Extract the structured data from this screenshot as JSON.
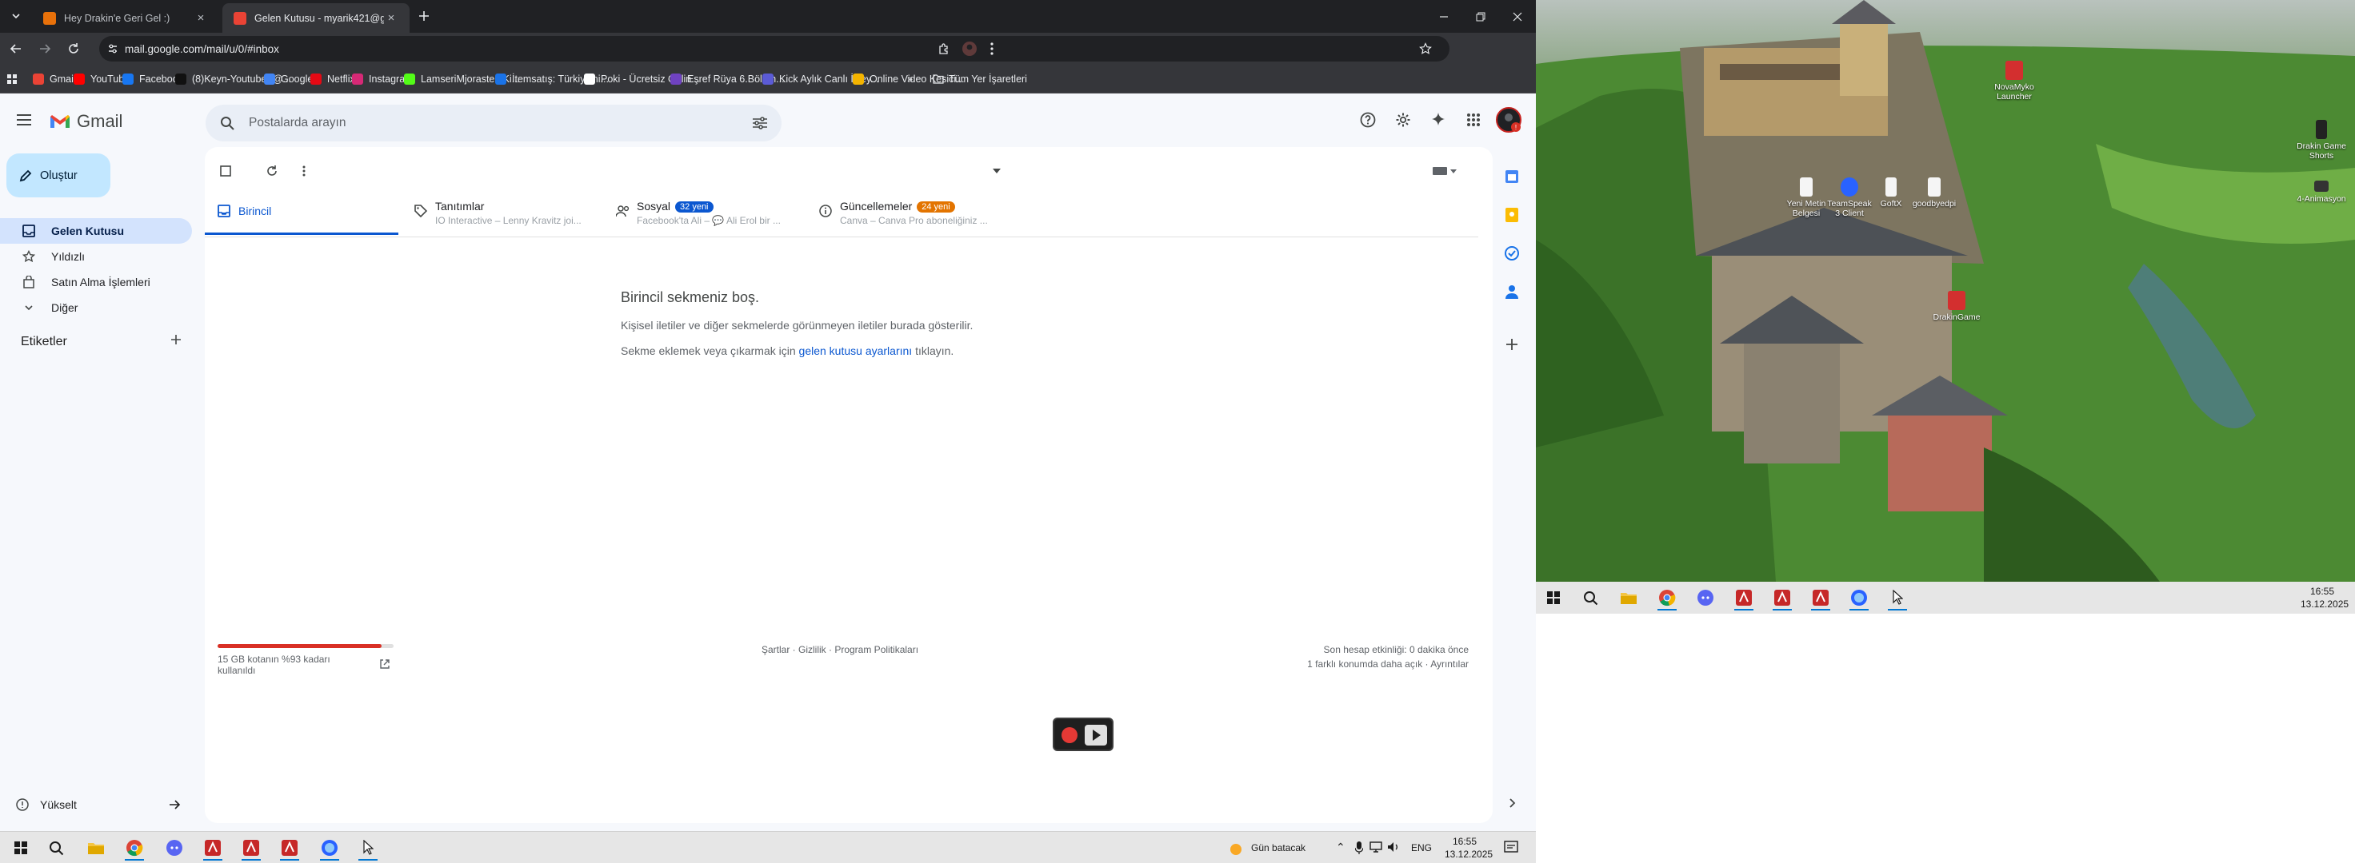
{
  "browser": {
    "tabs": [
      {
        "title": "Hey Drakin'e Geri Gel :)",
        "favicon_color": "#e8710a"
      },
      {
        "title": "Gelen Kutusu - myarik421@g...",
        "favicon_color": "#ea4335"
      }
    ],
    "url": "mail.google.com/mail/u/0/#inbox",
    "bookmarks": [
      {
        "label": "Gmail",
        "color": "#ea4335"
      },
      {
        "label": "YouTube",
        "color": "#ff0000"
      },
      {
        "label": "Facebook",
        "color": "#1877f2"
      },
      {
        "label": "(8)Keyn-Youtube (@...",
        "color": "#111111"
      },
      {
        "label": "Google",
        "color": "#4285f4"
      },
      {
        "label": "Netflix",
        "color": "#e50914"
      },
      {
        "label": "Instagram",
        "color": "#d62976"
      },
      {
        "label": "LamseriMjoraste | Ki...",
        "color": "#53fc18"
      },
      {
        "label": "İtemsatış: Türkiye'ni...",
        "color": "#1a73e8"
      },
      {
        "label": "Poki - Ücretsiz Onlin...",
        "color": "#ffffff"
      },
      {
        "label": "Eşref Rüya 6.Bölüm...",
        "color": "#6f42c1"
      },
      {
        "label": "Kick Aylık Canlı İzley...",
        "color": "#5b5bd6"
      },
      {
        "label": "Online Video Kesici...",
        "color": "#f4b400"
      }
    ],
    "all_bookmarks_label": "Tüm Yer İşaretleri"
  },
  "gmail": {
    "logo_text": "Gmail",
    "search_placeholder": "Postalarda arayın",
    "compose_label": "Oluştur",
    "nav": [
      {
        "label": "Gelen Kutusu",
        "icon": "inbox-icon",
        "active": true
      },
      {
        "label": "Yıldızlı",
        "icon": "star-icon",
        "active": false
      },
      {
        "label": "Satın Alma İşlemleri",
        "icon": "bag-icon",
        "active": false
      },
      {
        "label": "Diğer",
        "icon": "chevron-down-icon",
        "active": false
      }
    ],
    "labels_heading": "Etiketler",
    "upgrade_label": "Yükselt",
    "categories": [
      {
        "title": "Birincil",
        "subtitle": "",
        "badge": "",
        "badge_color": ""
      },
      {
        "title": "Tanıtımlar",
        "subtitle": "IO Interactive – Lenny Kravitz joi...",
        "badge": "",
        "badge_color": ""
      },
      {
        "title": "Sosyal",
        "subtitle": "Facebook'ta Ali – 💬 Ali Erol bir ...",
        "badge": "32 yeni",
        "badge_color": "#0b57d0"
      },
      {
        "title": "Güncellemeler",
        "subtitle": "Canva – Canva Pro aboneliğiniz ...",
        "badge": "24 yeni",
        "badge_color": "#e37400"
      }
    ],
    "empty_title": "Birincil sekmeniz boş.",
    "empty_line1": "Kişisel iletiler ve diğer sekmelerde görünmeyen iletiler burada gösterilir.",
    "empty_line2_pre": "Sekme eklemek veya çıkarmak için",
    "empty_line2_link": "gelen kutusu ayarlarını",
    "empty_line2_post": "tıklayın.",
    "storage_text_1": "15 GB kotanın %93 kadarı",
    "storage_text_2": "kullanıldı",
    "storage_fraction": 0.93,
    "footer_links": "Şartlar · Gizlilik · Program Politikaları",
    "last_activity": "Son hesap etkinliği: 0 dakika önce",
    "other_location": "1 farklı konumda daha açık · Ayrıntılar"
  },
  "taskbar_left": {
    "weather": "Gün batacak",
    "lang": "ENG",
    "time": "16:55",
    "date": "13.12.2025"
  },
  "desktop_right": {
    "icons": [
      {
        "label": "NovaMyko Launcher",
        "color": "#d32f2f"
      },
      {
        "label": "Drakin Game Shorts",
        "color": "#ffffff"
      },
      {
        "label": "Yeni Metin Belgesi",
        "color": "#ffffff"
      },
      {
        "label": "TeamSpeak 3 Client",
        "color": "#2962ff"
      },
      {
        "label": "GoftX",
        "color": "#ffffff"
      },
      {
        "label": "goodbyedpi",
        "color": "#ffffff"
      },
      {
        "label": "4-Animasyon",
        "color": "#333333"
      },
      {
        "label": "DrakinGame",
        "color": "#d32f2f"
      }
    ],
    "time": "16:55",
    "date": "13.12.2025"
  }
}
